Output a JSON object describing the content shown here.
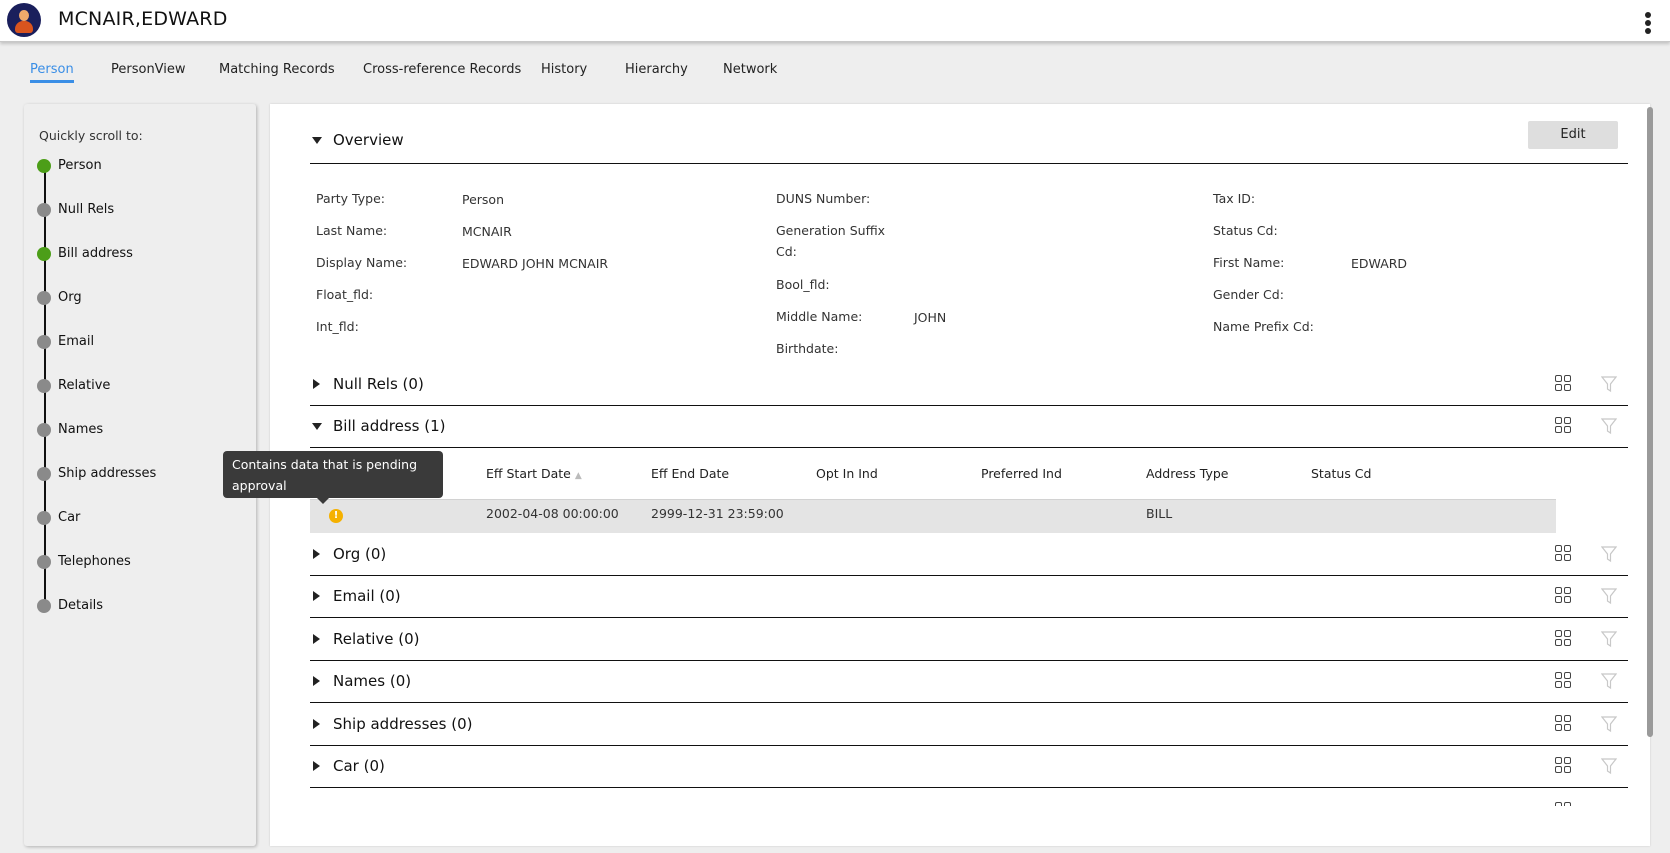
{
  "header": {
    "title": "MCNAIR,EDWARD",
    "avatar_icon": "person-avatar-icon",
    "menu_icon": "kebab-menu-icon"
  },
  "tabs": [
    {
      "label": "Person",
      "active": true
    },
    {
      "label": "PersonView",
      "active": false
    },
    {
      "label": "Matching Records",
      "active": false
    },
    {
      "label": "Cross-reference Records",
      "active": false
    },
    {
      "label": "History",
      "active": false
    },
    {
      "label": "Hierarchy",
      "active": false
    },
    {
      "label": "Network",
      "active": false
    }
  ],
  "sidebar": {
    "title": "Quickly scroll to:",
    "items": [
      {
        "label": "Person",
        "status": "green"
      },
      {
        "label": "Null Rels",
        "status": "gray"
      },
      {
        "label": "Bill address",
        "status": "green"
      },
      {
        "label": "Org",
        "status": "gray"
      },
      {
        "label": "Email",
        "status": "gray"
      },
      {
        "label": "Relative",
        "status": "gray"
      },
      {
        "label": "Names",
        "status": "gray"
      },
      {
        "label": "Ship addresses",
        "status": "gray"
      },
      {
        "label": "Car",
        "status": "gray"
      },
      {
        "label": "Telephones",
        "status": "gray"
      },
      {
        "label": "Details",
        "status": "gray"
      }
    ]
  },
  "overview": {
    "title": "Overview",
    "edit_label": "Edit",
    "fields": {
      "party_type": {
        "label": "Party Type:",
        "value": "Person"
      },
      "last_name": {
        "label": "Last Name:",
        "value": "MCNAIR"
      },
      "display_name": {
        "label": "Display Name:",
        "value": "EDWARD JOHN MCNAIR"
      },
      "float_fld": {
        "label": "Float_fld:",
        "value": ""
      },
      "int_fld": {
        "label": "Int_fld:",
        "value": ""
      },
      "duns_number": {
        "label": "DUNS Number:",
        "value": ""
      },
      "generation_suffix": {
        "label": "Generation Suffix Cd:",
        "value": ""
      },
      "bool_fld": {
        "label": "Bool_fld:",
        "value": ""
      },
      "middle_name": {
        "label": "Middle Name:",
        "value": "JOHN"
      },
      "birthdate": {
        "label": "Birthdate:",
        "value": ""
      },
      "tax_id": {
        "label": "Tax ID:",
        "value": ""
      },
      "status_cd": {
        "label": "Status Cd:",
        "value": ""
      },
      "first_name": {
        "label": "First Name:",
        "value": "EDWARD"
      },
      "gender_cd": {
        "label": "Gender Cd:",
        "value": ""
      },
      "name_prefix_cd": {
        "label": "Name Prefix Cd:",
        "value": ""
      }
    }
  },
  "sections": [
    {
      "label": "Null Rels (0)",
      "expanded": false
    },
    {
      "label": "Bill address (1)",
      "expanded": true
    },
    {
      "label": "Org (0)",
      "expanded": false
    },
    {
      "label": "Email (0)",
      "expanded": false
    },
    {
      "label": "Relative (0)",
      "expanded": false
    },
    {
      "label": "Names (0)",
      "expanded": false
    },
    {
      "label": "Ship addresses (0)",
      "expanded": false
    },
    {
      "label": "Car (0)",
      "expanded": false
    }
  ],
  "bill_address_table": {
    "columns": [
      "Eff Start Date",
      "Eff End Date",
      "Opt In Ind",
      "Preferred Ind",
      "Address Type",
      "Status Cd"
    ],
    "sort_indicator": "▲",
    "rows": [
      {
        "status_icon": "pending-warning-icon",
        "eff_start_date": "2002-04-08 00:00:00",
        "eff_end_date": "2999-12-31 23:59:00",
        "opt_in_ind": "",
        "preferred_ind": "",
        "address_type": "BILL",
        "status_cd": ""
      }
    ]
  },
  "tooltip": {
    "text": "Contains data that is pending approval"
  },
  "colors": {
    "accent": "#3a8ee6",
    "status_green": "#4c9e18",
    "status_gray": "#8a8a8a",
    "warning": "#f5b100"
  }
}
